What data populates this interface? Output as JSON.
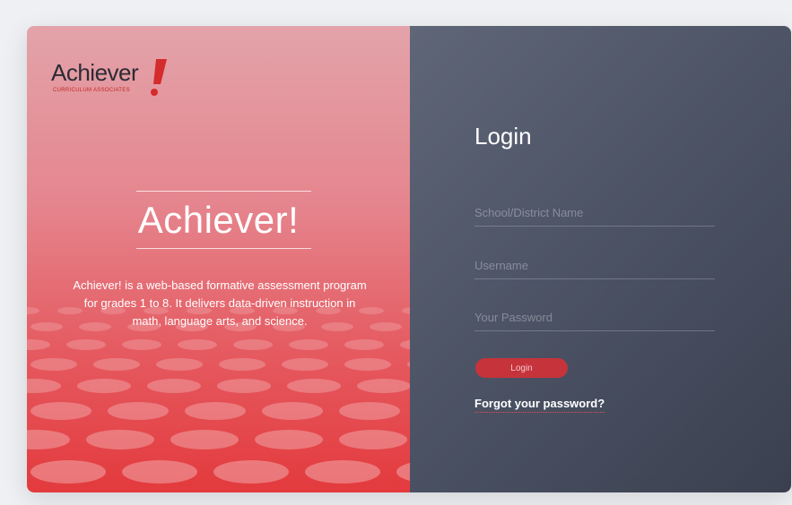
{
  "brand": {
    "logo_text": "Achiever",
    "logo_tagline": "CURRICULUM ASSOCIATES",
    "accent_color": "#d42b2b"
  },
  "hero": {
    "title": "Achiever!",
    "description": "Achiever! is a web-based formative assessment program for grades 1 to 8. It delivers data-driven instruction in math, language arts, and science."
  },
  "login": {
    "title": "Login",
    "school_placeholder": "School/District Name",
    "username_placeholder": "Username",
    "password_placeholder": "Your Password",
    "button_label": "Login",
    "forgot_label": "Forgot your password?"
  },
  "colors": {
    "left_panel_top": "#e3a3aa",
    "left_panel_bottom": "#e33a3d",
    "right_panel": "#4d5466",
    "button": "#c6333b"
  }
}
